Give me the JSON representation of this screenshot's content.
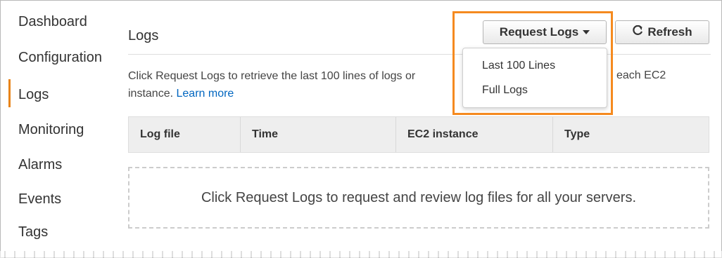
{
  "sidebar": {
    "items": [
      {
        "label": "Dashboard"
      },
      {
        "label": "Configuration"
      },
      {
        "label": "Logs"
      },
      {
        "label": "Monitoring"
      },
      {
        "label": "Alarms"
      },
      {
        "label": "Events"
      },
      {
        "label": "Tags"
      }
    ],
    "active_index": 2,
    "active_color": "#e8841a"
  },
  "header": {
    "title": "Logs"
  },
  "toolbar": {
    "request_logs_label": "Request Logs",
    "refresh_label": "Refresh",
    "refresh_icon": "refresh-icon"
  },
  "dropdown": {
    "items": [
      {
        "label": "Last 100 Lines"
      },
      {
        "label": "Full Logs"
      }
    ],
    "highlight_color": "#f58a1f"
  },
  "description": {
    "text_before": "Click Request Logs to retrieve the last 100 lines of logs or",
    "text_after": "each EC2",
    "line2": "instance.",
    "learn_more": "Learn more",
    "link_color": "#0066c0"
  },
  "table": {
    "columns": [
      "Log file",
      "Time",
      "EC2 instance",
      "Type"
    ],
    "empty_message": "Click Request Logs to request and review log files for all your servers."
  }
}
